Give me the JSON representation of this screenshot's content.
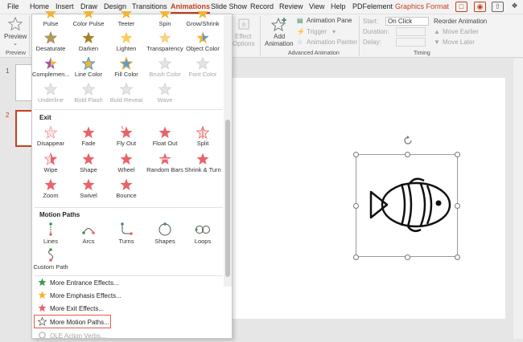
{
  "menubar": {
    "tabs": [
      "File",
      "Home",
      "Insert",
      "Draw",
      "Design",
      "Transitions",
      "Animations",
      "Slide Show",
      "Record",
      "Review",
      "View",
      "Help",
      "PDFelement",
      "Graphics Format"
    ],
    "active_tab": "Animations"
  },
  "ribbon": {
    "preview": "Preview",
    "preview_group": "Preview",
    "effect_options_1": "Effect",
    "effect_options_2": "Options",
    "add_animation_1": "Add",
    "add_animation_2": "Animation",
    "animation_pane": "Animation Pane",
    "trigger": "Trigger",
    "animation_painter": "Animation Painter",
    "advanced_group": "Advanced Animation",
    "start_label": "Start:",
    "start_value": "On Click",
    "duration_label": "Duration:",
    "delay_label": "Delay:",
    "timing_group": "Timing",
    "reorder_title": "Reorder Animation",
    "move_earlier": "Move Earlier",
    "move_later": "Move Later"
  },
  "slides": {
    "numbers": [
      "1",
      "2"
    ]
  },
  "dropdown": {
    "emphasis_rows": [
      [
        "Pulse",
        "Color Pulse",
        "Teeter",
        "Spin",
        "Grow/Shrink"
      ],
      [
        "Desaturate",
        "Darken",
        "Lighten",
        "Transparency",
        "Object Color"
      ],
      [
        "Complemen...",
        "Line Color",
        "Fill Color",
        "Brush Color",
        "Font Color"
      ],
      [
        "Underline",
        "Bold Flash",
        "Bold Reveal",
        "Wave"
      ]
    ],
    "exit_header": "Exit",
    "exit_rows": [
      [
        "Disappear",
        "Fade",
        "Fly Out",
        "Float Out",
        "Split"
      ],
      [
        "Wipe",
        "Shape",
        "Wheel",
        "Random Bars",
        "Shrink & Turn"
      ],
      [
        "Zoom",
        "Swivel",
        "Bounce"
      ]
    ],
    "motion_header": "Motion Paths",
    "motion_items": [
      "Lines",
      "Arcs",
      "Turns",
      "Shapes",
      "Loops",
      "Custom Path"
    ],
    "more_items": [
      "More Entrance Effects...",
      "More Emphasis Effects...",
      "More Exit Effects...",
      "More Motion Paths...",
      "OLE Action Verbs..."
    ]
  },
  "colors": {
    "accent": "#c43e1c",
    "emphasis_star": "#f2b533",
    "exit_star": "#e8636a",
    "highlight_box": "#e05a4a"
  }
}
